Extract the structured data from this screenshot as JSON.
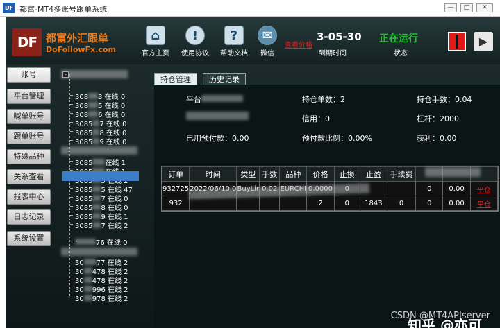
{
  "window": {
    "logo": "DF",
    "title": "都富-MT4多账号跟单系统",
    "min": "—",
    "max": "□",
    "close": "✕"
  },
  "brand": {
    "logo": "DF",
    "name_cn": "都富外汇跟单",
    "name_en": "DoFollowFx.com"
  },
  "toolbar": [
    {
      "label": "官方主页",
      "icon": "home-icon",
      "glyph": "⌂"
    },
    {
      "label": "使用协议",
      "icon": "info-icon",
      "glyph": "!"
    },
    {
      "label": "帮助文档",
      "icon": "help-icon",
      "glyph": "?"
    },
    {
      "label": "微信",
      "icon": "wechat-icon",
      "glyph": "✉"
    }
  ],
  "price_link": "查看价格",
  "expire": {
    "value": "3-05-30",
    "label": "到期时间"
  },
  "status": {
    "value": "正在运行",
    "label": "状态",
    "color": "#22c02e"
  },
  "sidebar": [
    "账号",
    "平台管理",
    "喊单账号",
    "跟单账号",
    "特殊品种",
    "关系查看",
    "报表中心",
    "日志记录",
    "系统设置"
  ],
  "tree": {
    "group1": [
      {
        "id": "308",
        "suffix": "3 在线 0"
      },
      {
        "id": "308",
        "suffix": "5 在线 0"
      },
      {
        "id": "308",
        "suffix": "6 在线 0"
      },
      {
        "id": "3085",
        "suffix": "7 在线 0"
      },
      {
        "id": "3085",
        "suffix": "8 在线 0"
      },
      {
        "id": "3085",
        "suffix": "9 在线 0"
      }
    ],
    "group2": [
      {
        "id": "3085",
        "suffix": "在线 1"
      },
      {
        "id": "3085",
        "suffix": "在线 1"
      },
      {
        "id": "3085",
        "suffix": "5 在线 2"
      },
      {
        "id": "3085",
        "suffix": "5 在线 47"
      },
      {
        "id": "3085",
        "suffix": "7 在线 0"
      },
      {
        "id": "3085",
        "suffix": "8 在线 0"
      },
      {
        "id": "3085",
        "suffix": "9 在线 1"
      },
      {
        "id": "3085",
        "suffix": "7 在线 2"
      },
      {
        "id": "",
        "suffix": "76 在线 0"
      }
    ],
    "group3": [
      {
        "id": "30",
        "suffix": "77 在线 2"
      },
      {
        "id": "30",
        "suffix": "478 在线 2"
      },
      {
        "id": "30",
        "suffix": "478 在线 2"
      },
      {
        "id": "30",
        "suffix": "996 在线 2"
      },
      {
        "id": "30",
        "suffix": "978 在线 2"
      }
    ]
  },
  "tabs": [
    "持仓管理",
    "历史记录"
  ],
  "info": {
    "platform": "平台",
    "order_count": "持仓单数：2",
    "lots": "持仓手数：0.04",
    "credit": "信用：0",
    "leverage": "杠杆：2000",
    "used_margin": "已用预付款：0.00",
    "margin_ratio": "预付款比例：0.00%",
    "profit": "获利：0.00"
  },
  "table": {
    "headers": [
      "订单",
      "时间",
      "类型",
      "手数",
      "品种",
      "价格",
      "止损",
      "止盈",
      "手续费",
      "",
      "",
      ""
    ],
    "rows": [
      [
        "932725",
        "2022/06/10 0",
        "BuyLir",
        "0.02",
        "EURCHI",
        "0.0000",
        "0",
        "",
        "",
        "0",
        "0.00",
        "平仓"
      ],
      [
        "932",
        "",
        "",
        "",
        "",
        "2",
        "0",
        "1843",
        "0",
        "0",
        "0.00",
        "平仓"
      ]
    ]
  },
  "watermark": {
    "zhihu": "知乎 @亦可",
    "csdn": "CSDN @MT4APIserver"
  }
}
